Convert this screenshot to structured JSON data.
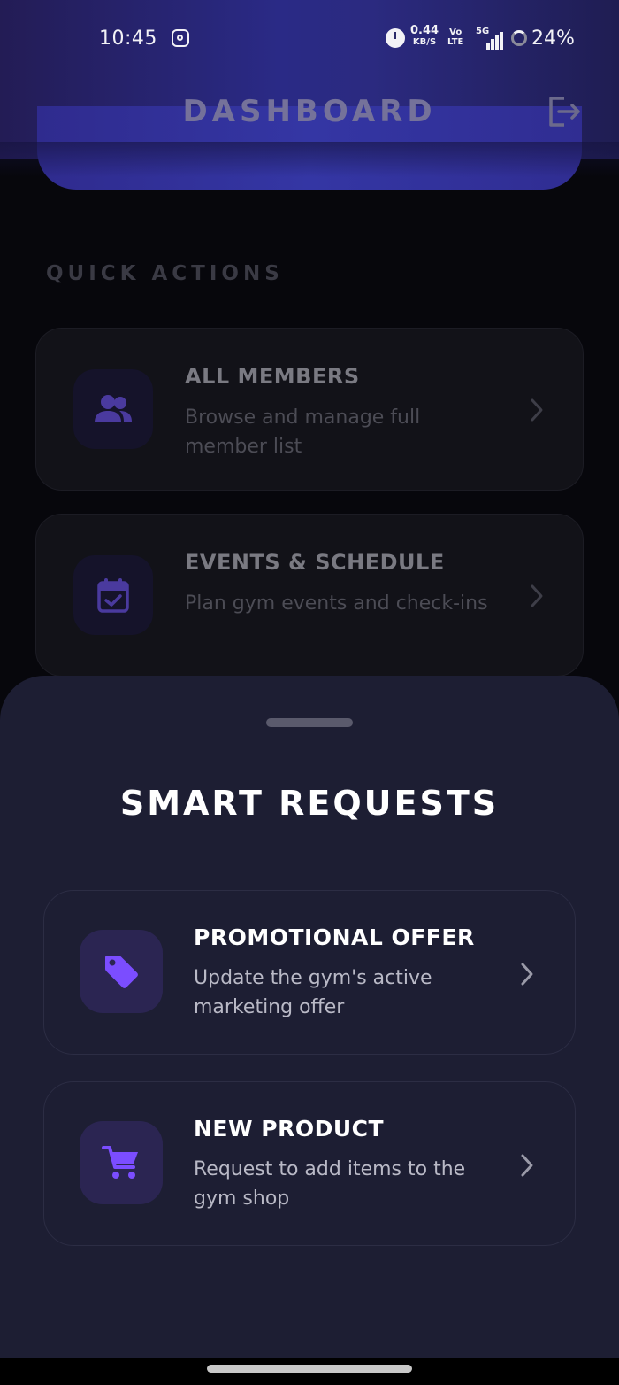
{
  "status_bar": {
    "time": "10:45",
    "speed_value": "0.44",
    "speed_unit": "KB/S",
    "volte_top": "Vo",
    "volte_bottom": "LTE",
    "network": "5G",
    "battery": "24%",
    "icons": [
      "instagram-icon",
      "alarm-icon",
      "signal-icon",
      "battery-ring-icon"
    ]
  },
  "header": {
    "title": "DASHBOARD",
    "logout_icon": "logout-icon"
  },
  "quick_actions": {
    "label": "QUICK ACTIONS",
    "items": [
      {
        "title": "ALL MEMBERS",
        "description": "Browse and manage full member list",
        "icon": "members-icon"
      },
      {
        "title": "EVENTS & SCHEDULE",
        "description": "Plan gym events and check-ins",
        "icon": "calendar-check-icon"
      }
    ]
  },
  "sheet": {
    "title": "SMART REQUESTS",
    "items": [
      {
        "title": "PROMOTIONAL OFFER",
        "description": "Update the gym's active marketing offer",
        "icon": "tag-icon"
      },
      {
        "title": "NEW PRODUCT",
        "description": "Request to add items to the gym shop",
        "icon": "cart-icon"
      }
    ]
  },
  "colors": {
    "accent": "#7b4dff",
    "sheet_bg": "#1d1e33",
    "header_gradient": "#2a2a86"
  }
}
